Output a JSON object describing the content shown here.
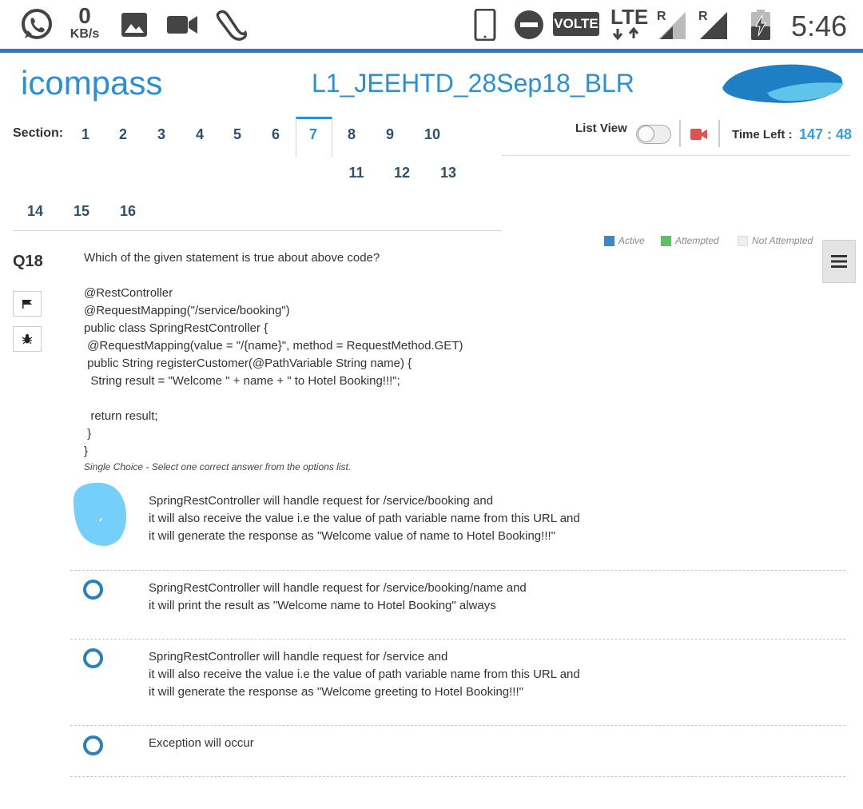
{
  "status_bar": {
    "icons": [
      "whatsapp-icon",
      "image-icon",
      "video-camera-icon",
      "footprint-icon",
      "phone-icon",
      "do-not-disturb-icon",
      "signal-icon",
      "battery-icon"
    ],
    "speed_value": "0",
    "speed_unit": "KB/s",
    "volte": "VOLTE",
    "lte": "LTE",
    "roaming_1": "R",
    "roaming_2": "R",
    "time": "5:46"
  },
  "header": {
    "logo_text": "icompass",
    "title": "L1_JEEHTD_28Sep18_BLR"
  },
  "sections": {
    "label": "Section:",
    "items": [
      "1",
      "2",
      "3",
      "4",
      "5",
      "6",
      "7",
      "8",
      "9",
      "10",
      "11",
      "12",
      "13",
      "14",
      "15",
      "16"
    ],
    "active": "7"
  },
  "controls": {
    "list_view_label": "List View",
    "time_left_label": "Time Left :",
    "time_left_value": "147 : 48"
  },
  "legend": {
    "active": "Active",
    "attempted": "Attempted",
    "not_attempted": "Not Attempted",
    "colors": {
      "active": "#3d86c9",
      "attempted": "#5cc165",
      "not_attempted": "#eeeeee"
    }
  },
  "question": {
    "number": "Q18",
    "text": "Which of the given statement is true about above code?\n\n@RestController\n@RequestMapping(\"/service/booking\")\npublic class SpringRestController {\n @RequestMapping(value = \"/{name}\", method = RequestMethod.GET)\n public String registerCustomer(@PathVariable String name) {\n  String result = \"Welcome \" + name + \" to Hotel Booking!!!\";\n\n  return result;\n }\n}",
    "hint": "Single Choice - Select one correct answer from the options list."
  },
  "options": [
    {
      "line1": "SpringRestController will handle request for /service/booking and",
      "line2": "it will also receive the value i.e the value of path variable name from this URL and",
      "line3": "it will generate the response as \"Welcome value of name to Hotel Booking!!!\"",
      "selected": true
    },
    {
      "line1": "SpringRestController will handle request for /service/booking/name and",
      "line2": "it will print the result as \"Welcome name to Hotel Booking\" always",
      "selected": false
    },
    {
      "line1": "SpringRestController will handle request for /service and",
      "line2": "it will also receive the value i.e the value of path variable name from this URL and",
      "line3": "it will generate the response as \"Welcome greeting to Hotel Booking!!!\"",
      "selected": false
    },
    {
      "line1": "Exception will occur",
      "selected": false
    }
  ],
  "accent_color": "#2b8fd8"
}
